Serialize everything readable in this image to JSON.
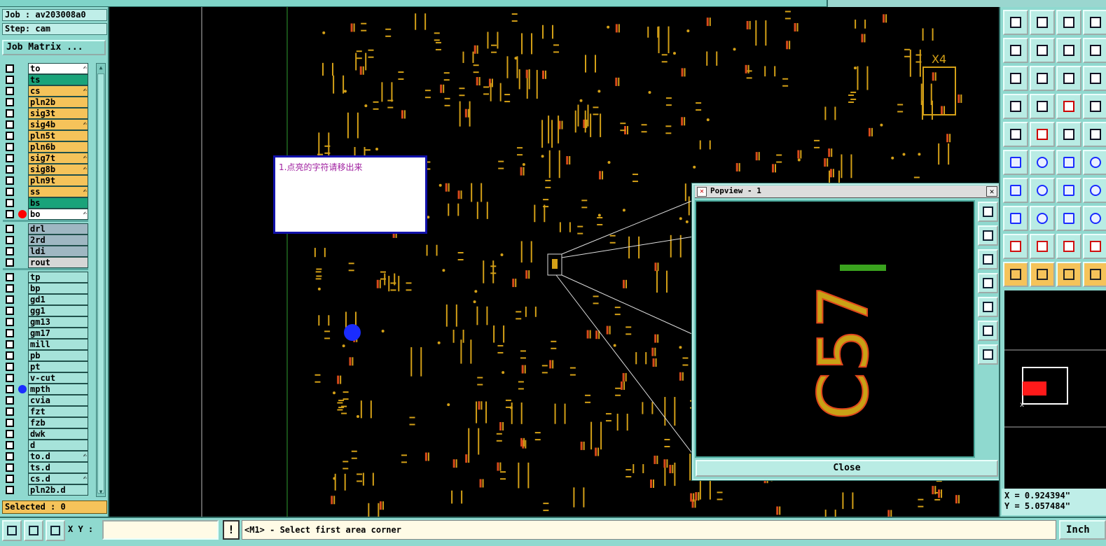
{
  "job_label": "Job : av203008a0",
  "step_label": "Step: cam",
  "job_matrix_label": "Job Matrix ...",
  "layers": [
    {
      "name": "to",
      "color": "#ffffff",
      "pen": "✍"
    },
    {
      "name": "ts",
      "color": "#1aa37a",
      "pen": ""
    },
    {
      "name": "cs",
      "color": "#f5c35a",
      "pen": "✍"
    },
    {
      "name": "pln2b",
      "color": "#f5c35a",
      "pen": ""
    },
    {
      "name": "sig3t",
      "color": "#f5c35a",
      "pen": ""
    },
    {
      "name": "sig4b",
      "color": "#f5c35a",
      "pen": "✍"
    },
    {
      "name": "pln5t",
      "color": "#f5c35a",
      "pen": ""
    },
    {
      "name": "pln6b",
      "color": "#f5c35a",
      "pen": ""
    },
    {
      "name": "sig7t",
      "color": "#f5c35a",
      "pen": "✍"
    },
    {
      "name": "sig8b",
      "color": "#f5c35a",
      "pen": "✍"
    },
    {
      "name": "pln9t",
      "color": "#f5c35a",
      "pen": ""
    },
    {
      "name": "ss",
      "color": "#f5c35a",
      "pen": "✍"
    },
    {
      "name": "bs",
      "color": "#1aa37a",
      "pen": ""
    },
    {
      "name": "bo",
      "color": "#ffffff",
      "pen": "✍"
    }
  ],
  "drill_layers": [
    {
      "name": "drl",
      "color": "#9fb7c2"
    },
    {
      "name": "2rd",
      "color": "#9fb7c2"
    },
    {
      "name": "ldi",
      "color": "#9fb7c2"
    },
    {
      "name": "rout",
      "color": "#d6d6d6"
    }
  ],
  "misc_layers": [
    {
      "name": "tp",
      "pen": ""
    },
    {
      "name": "bp",
      "pen": ""
    },
    {
      "name": "gd1",
      "pen": ""
    },
    {
      "name": "gg1",
      "pen": ""
    },
    {
      "name": "gm13",
      "pen": ""
    },
    {
      "name": "gm17",
      "pen": ""
    },
    {
      "name": "mill",
      "pen": ""
    },
    {
      "name": "pb",
      "pen": ""
    },
    {
      "name": "pt",
      "pen": ""
    },
    {
      "name": "v-cut",
      "pen": ""
    },
    {
      "name": "mpth",
      "pen": ""
    },
    {
      "name": "cvia",
      "pen": ""
    },
    {
      "name": "fzt",
      "pen": ""
    },
    {
      "name": "fzb",
      "pen": ""
    },
    {
      "name": "dwk",
      "pen": ""
    },
    {
      "name": "d",
      "pen": ""
    },
    {
      "name": "to.d",
      "pen": "✍"
    },
    {
      "name": "ts.d",
      "pen": ""
    },
    {
      "name": "cs.d",
      "pen": "✍"
    },
    {
      "name": "pln2b.d",
      "pen": ""
    }
  ],
  "selected_label": "Selected : 0",
  "note_text": "1.点亮的字符请移出来",
  "popview": {
    "title": "Popview - 1",
    "close_label": "Close",
    "zoom_text": "C57"
  },
  "canvas_text": {
    "x4": "X4"
  },
  "coords": {
    "x": "X = 0.924394\"",
    "y": "Y = 5.057484\""
  },
  "bottom": {
    "xy_label": "X Y :",
    "xy_value": "",
    "warn_symbol": "!",
    "message": "<M1> - Select first area corner",
    "units": "Inch"
  },
  "colors": {
    "panel": "#8fd9cf",
    "layer_yellow": "#f5c35a",
    "layer_green": "#1aa37a",
    "silk": "#d4a017",
    "marker_red": "#ff0000",
    "marker_blue": "#1a2cff"
  }
}
